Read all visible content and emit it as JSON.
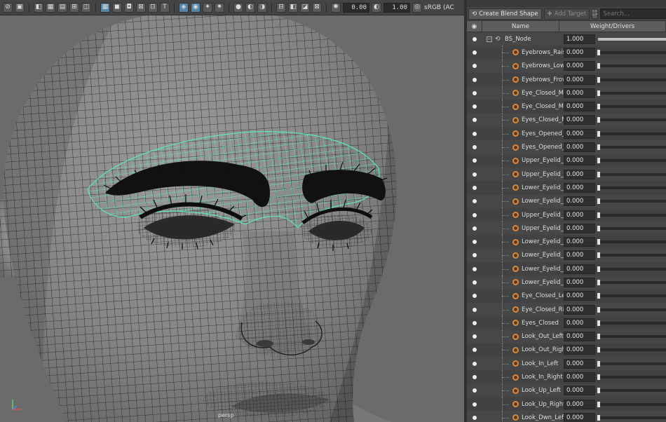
{
  "toolbar": {
    "exposure_value": "0.00",
    "gamma_value": "1.00",
    "color_space": "sRGB (AC"
  },
  "viewport": {
    "camera_label": "persp"
  },
  "panel": {
    "create_button_label": "Create Blend Shape",
    "add_target_label": "Add Target",
    "search_placeholder": "Search...",
    "header": {
      "name": "Name",
      "weight": "Weight/Drivers"
    },
    "blend_node": {
      "name": "BS_Node",
      "value": "1.000"
    },
    "targets": [
      {
        "name": "Eyebrows_Raised",
        "value": "0.000",
        "weight": 0
      },
      {
        "name": "Eyebrows_Lowered",
        "value": "0.000",
        "weight": 0
      },
      {
        "name": "Eyebrows_Frown",
        "value": "0.000",
        "weight": 0
      },
      {
        "name": "Eye_Closed_Max",
        "value": "0.000",
        "weight": 0
      },
      {
        "name": "Eye_Closed_Max",
        "value": "0.000",
        "weight": 0
      },
      {
        "name": "Eyes_Closed_Max",
        "value": "0.000",
        "weight": 0
      },
      {
        "name": "Eyes_Opened_M",
        "value": "0.000",
        "weight": 0
      },
      {
        "name": "Eyes_Opened_M",
        "value": "0.000",
        "weight": 0
      },
      {
        "name": "Upper_Eyelid_Up",
        "value": "0.000",
        "weight": 0
      },
      {
        "name": "Upper_Eyelid_Up",
        "value": "0.000",
        "weight": 0
      },
      {
        "name": "Lower_Eyelid_Up",
        "value": "0.000",
        "weight": 0
      },
      {
        "name": "Lower_Eyelid_Up",
        "value": "0.000",
        "weight": 0
      },
      {
        "name": "Upper_Eyelid_Dr",
        "value": "0.000",
        "weight": 0
      },
      {
        "name": "Upper_Eyelid_Dr",
        "value": "0.000",
        "weight": 0
      },
      {
        "name": "Lower_Eyelid_Dr",
        "value": "0.000",
        "weight": 0
      },
      {
        "name": "Lower_Eyelid_Dr",
        "value": "0.000",
        "weight": 0
      },
      {
        "name": "Lower_Eyelid_Sq",
        "value": "0.000",
        "weight": 0
      },
      {
        "name": "Lower_Eyelid_Sq",
        "value": "0.000",
        "weight": 0
      },
      {
        "name": "Eye_Closed_Left",
        "value": "0.000",
        "weight": 0
      },
      {
        "name": "Eye_Closed_Right",
        "value": "0.000",
        "weight": 0
      },
      {
        "name": "Eyes_Closed",
        "value": "0.000",
        "weight": 0
      },
      {
        "name": "Look_Out_Left",
        "value": "0.000",
        "weight": 0
      },
      {
        "name": "Look_Out_Right",
        "value": "0.000",
        "weight": 0
      },
      {
        "name": "Look_In_Left",
        "value": "0.000",
        "weight": 0
      },
      {
        "name": "Look_In_Right",
        "value": "0.000",
        "weight": 0
      },
      {
        "name": "Look_Up_Left",
        "value": "0.000",
        "weight": 0
      },
      {
        "name": "Look_Up_Right",
        "value": "0.000",
        "weight": 0
      },
      {
        "name": "Look_Dwn_Left",
        "value": "0.000",
        "weight": 0
      }
    ]
  },
  "colors": {
    "selection_wire": "#5fe6b0",
    "target_icon": "#d98a3a"
  }
}
